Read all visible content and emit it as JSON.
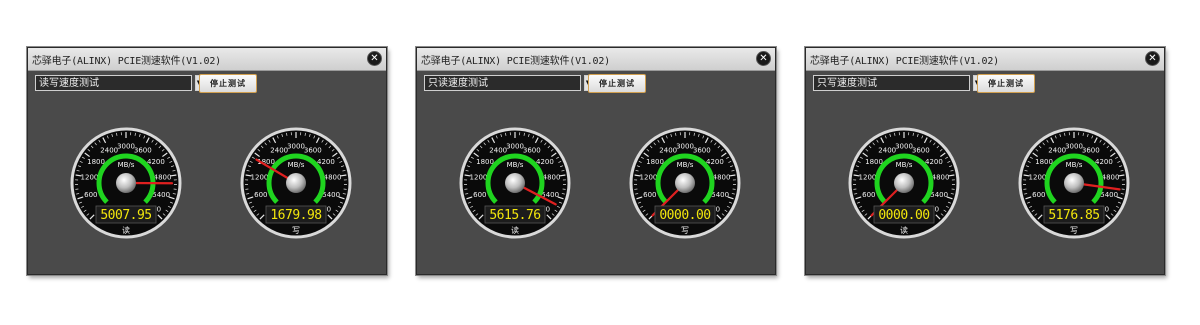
{
  "windows": [
    {
      "title": "芯驿电子(ALINX) PCIE测速软件(V1.02)",
      "mode": "读写速度测试",
      "button": "停止测试",
      "gauges": [
        {
          "label": "读",
          "reading": "5007.95",
          "value": 5007.95
        },
        {
          "label": "写",
          "reading": "1679.98",
          "value": 1679.98
        }
      ]
    },
    {
      "title": "芯驿电子(ALINX) PCIE测速软件(V1.02)",
      "mode": "只读速度测试",
      "button": "停止测试",
      "gauges": [
        {
          "label": "读",
          "reading": "5615.76",
          "value": 5615.76
        },
        {
          "label": "写",
          "reading": "0000.00",
          "value": 0
        }
      ]
    },
    {
      "title": "芯驿电子(ALINX) PCIE测速软件(V1.02)",
      "mode": "只写速度测试",
      "button": "停止测试",
      "gauges": [
        {
          "label": "读",
          "reading": "0000.00",
          "value": 0
        },
        {
          "label": "写",
          "reading": "5176.85",
          "value": 5176.85
        }
      ]
    }
  ],
  "gauge_scale": {
    "unit": "MB/s",
    "min": 0,
    "max": 6000,
    "ticks": [
      "0",
      "600",
      "1200",
      "1800",
      "2400",
      "3000",
      "3600",
      "4200",
      "4800",
      "5400",
      "6000"
    ]
  },
  "colors": {
    "arc": "#1fd41f",
    "needle": "#e02020",
    "lcd_text": "#f2e60c"
  },
  "icons": {
    "close": "close-icon",
    "dropdown": "chevron-down-icon"
  }
}
